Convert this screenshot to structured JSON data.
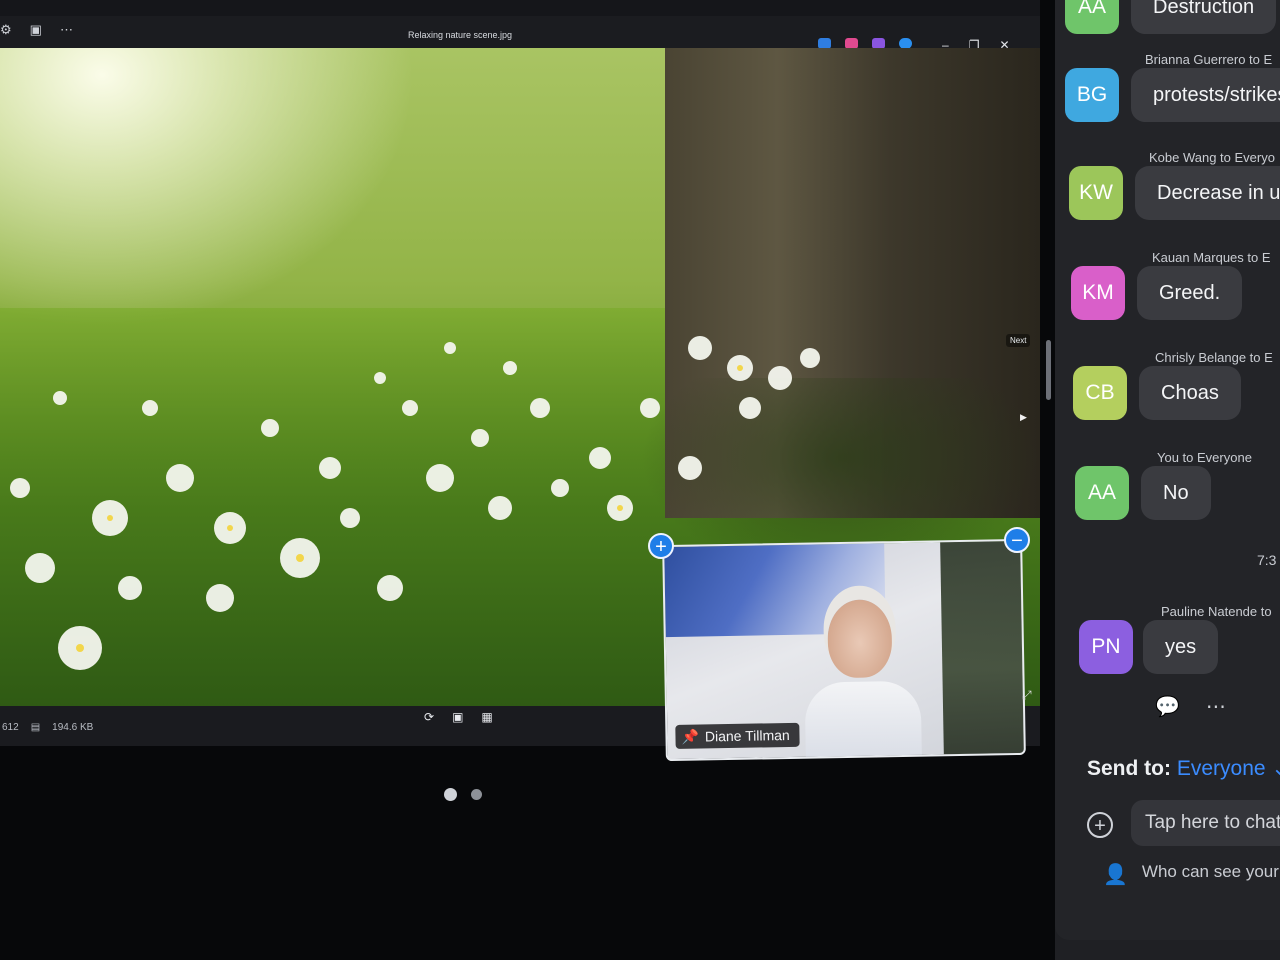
{
  "viewer": {
    "title": "Relaxing nature scene.jpg",
    "toolbar_left_icons": [
      "gallery-icon",
      "slideshow-icon",
      "more-icon"
    ],
    "app_icons": [
      "edit-icon",
      "paint-icon",
      "designer-icon",
      "onedrive-icon"
    ],
    "window_controls": [
      "minimize-icon",
      "restore-icon",
      "close-icon"
    ],
    "next_hint": "Next",
    "status": {
      "dimensions_partial": "612",
      "file_size": "194.6 KB"
    },
    "status_tools": [
      "rotate-icon",
      "fit-icon",
      "zoom-icon"
    ],
    "pager_active": 1,
    "pager_count": 2
  },
  "video": {
    "participant_name": "Diane Tillman"
  },
  "chat": {
    "messages": [
      {
        "header": "",
        "initials": "AA",
        "color": "#6fc56a",
        "text": "Destruction"
      },
      {
        "header": "Brianna Guerrero to E",
        "initials": "BG",
        "color": "#3fa8e0",
        "text": "protests/strikes"
      },
      {
        "header": "Kobe Wang to Everyo",
        "initials": "KW",
        "color": "#9cc65a",
        "text": "Decrease in un"
      },
      {
        "header": "Kauan Marques to E",
        "initials": "KM",
        "color": "#d95fc9",
        "text": "Greed."
      },
      {
        "header": "Chrisly Belange to E",
        "initials": "CB",
        "color": "#b4cf5e",
        "text": "Choas"
      },
      {
        "header": "You to Everyone",
        "initials": "AA",
        "color": "#6fc56a",
        "text": "No"
      }
    ],
    "time": "7:3",
    "last_message": {
      "header": "Pauline Natende to",
      "initials": "PN",
      "color": "#8c5fe0",
      "text": "yes"
    },
    "send_to_label": "Send to:",
    "send_to_value": "Everyone",
    "composer_placeholder": "Tap here to chat",
    "visibility_hint": "Who can see your"
  },
  "colors": {
    "accent_blue": "#1e7ee8",
    "chat_bg": "#232428",
    "bubble_bg": "#3a3b40"
  }
}
